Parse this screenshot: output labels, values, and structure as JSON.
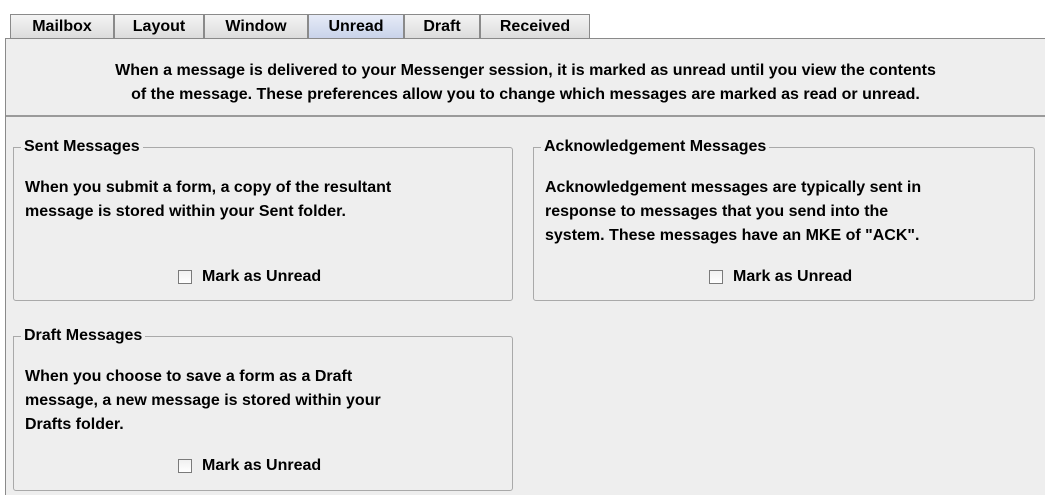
{
  "tabs": [
    {
      "label": "Mailbox",
      "selected": false
    },
    {
      "label": "Layout",
      "selected": false
    },
    {
      "label": "Window",
      "selected": false
    },
    {
      "label": "Unread",
      "selected": true
    },
    {
      "label": "Draft",
      "selected": false
    },
    {
      "label": "Received",
      "selected": false
    }
  ],
  "description": {
    "line1": "When a message is delivered to your Messenger session, it is marked as unread until you view the contents",
    "line2": "of the message.  These preferences allow you to change which messages are marked as read or unread."
  },
  "sent": {
    "title": "Sent Messages",
    "lines": [
      "When you submit a form, a copy of the resultant",
      "message is stored within your Sent folder."
    ],
    "checkbox_label": "Mark as Unread",
    "checked": false
  },
  "ack": {
    "title": "Acknowledgement Messages",
    "lines": [
      "Acknowledgement messages are typically sent in",
      "response to messages that you send into the",
      "system.  These messages have an MKE of \"ACK\"."
    ],
    "checkbox_label": "Mark as Unread",
    "checked": false
  },
  "draft": {
    "title": "Draft Messages",
    "lines": [
      "When you choose to save a form as a Draft",
      "message, a new message is stored within your",
      "Drafts folder."
    ],
    "checkbox_label": "Mark as Unread",
    "checked": false
  }
}
